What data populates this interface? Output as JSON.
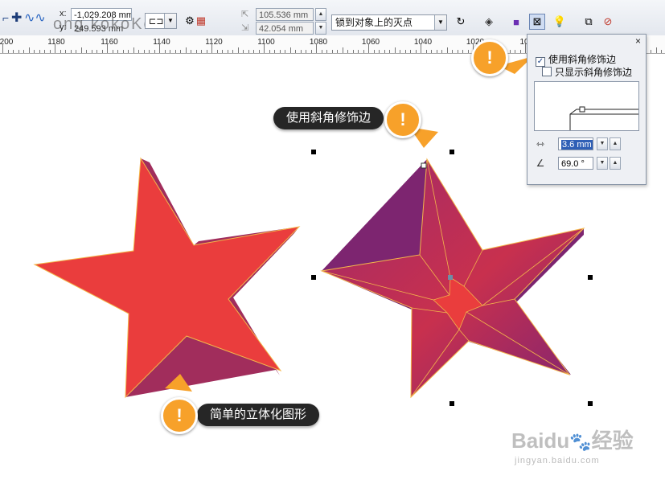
{
  "watermark_top": "ong kokoKok",
  "toolbar": {
    "x_label": "x:",
    "x_value": "-1,029.208 mm",
    "y_label": "y:",
    "y_value": "249.593 mm",
    "width_value": "105.536 mm",
    "height_value": "42.054 mm",
    "snap_select": "锁到对象上的灭点"
  },
  "ruler": {
    "labels": [
      "200",
      "1180",
      "1160",
      "1140",
      "1120",
      "1100",
      "1080",
      "1060",
      "1040",
      "1020",
      "10"
    ]
  },
  "callouts": {
    "bevel_use": "使用斜角修饰边",
    "simple_3d": "简单的立体化图形",
    "badge_symbol": "!"
  },
  "bevel_panel": {
    "close": "×",
    "use_bevel_label": "使用斜角修饰边",
    "show_bevel_only_label": "只显示斜角修饰边",
    "use_bevel_checked": true,
    "depth_value": "3.6 mm",
    "angle_value": "69.0 °"
  },
  "watermark_bottom": {
    "brand": "Baidu",
    "brand_cn": "经验",
    "url": "jingyan.baidu.com"
  },
  "colors": {
    "star_face": "#ea3d3d",
    "star_side": "#a12d5c",
    "star_bevel_dark": "#8a2a6c",
    "badge": "#f7a12a",
    "callout_bg": "#262626"
  }
}
